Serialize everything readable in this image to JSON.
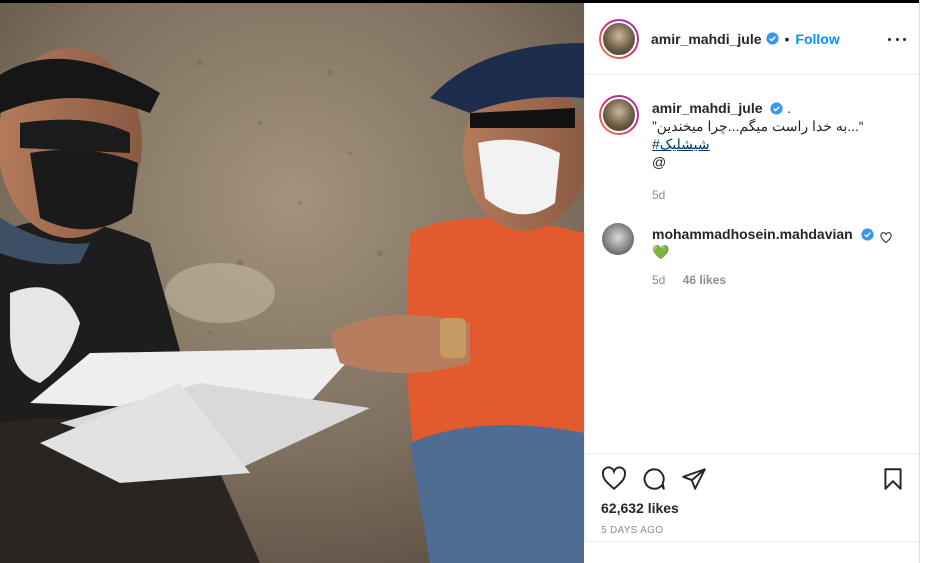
{
  "header": {
    "username": "amir_mahdi_jule",
    "separator": "•",
    "follow_label": "Follow"
  },
  "caption": {
    "username": "amir_mahdi_jule",
    "trailing": ".",
    "line1": "“...به خدا راست میگم...چرا میخندین”",
    "hashtag": "#شیشلیک",
    "line3": "@",
    "time": "5d"
  },
  "comment": {
    "username": "mohammadhosein.mahdavian",
    "text": "💚",
    "time": "5d",
    "likes": "46 likes"
  },
  "post": {
    "likes": "62,632 likes",
    "time": "5 DAYS AGO"
  },
  "colors": {
    "accent": "#0095f6",
    "text": "#262626",
    "muted": "#8e8e8e",
    "verified": "#3897f0"
  }
}
